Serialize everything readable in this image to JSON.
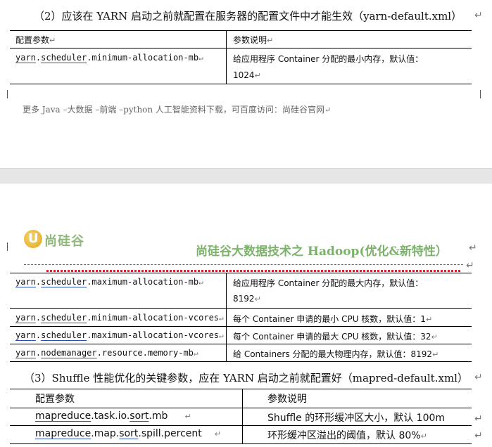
{
  "section2": {
    "heading": "（2）应该在 YARN 启动之前就配置在服务器的配置文件中才能生效（yarn-default.xml）",
    "header_param": "配置参数",
    "header_desc": "参数说明",
    "row1_param_a": "yarn",
    "row1_param_b": ".",
    "row1_param_c": "scheduler",
    "row1_param_d": ".minimum-allocation-mb",
    "row1_desc_l1": "给应用程序 Container 分配的最小内存，默认值：",
    "row1_desc_l2": "1024"
  },
  "footer": {
    "text": "更多 Java –大数据 –前端 –python 人工智能资料下载，可百度访问：尚硅谷官网"
  },
  "page_header": {
    "logo_text": "尚硅谷",
    "title": "尚硅谷大数据技术之 Hadoop(优化&新特性）"
  },
  "table2": {
    "rows": [
      {
        "p1": "yarn",
        "p2": ".",
        "p3": "scheduler",
        "p4": ".maximum-allocation-mb",
        "d1": "给应用程序 Container 分配的最大内存，默认值：",
        "d2": "8192"
      },
      {
        "p1": "yarn",
        "p2": ".",
        "p3": "scheduler",
        "p4": ".minimum-allocation-vcores",
        "d1": "每个 Container 申请的最小 CPU 核数，默认值：1"
      },
      {
        "p1": "yarn",
        "p2": ".",
        "p3": "scheduler",
        "p4": ".maximum-allocation-vcores",
        "d1": "每个 Container 申请的最大 CPU 核数，默认值：32"
      },
      {
        "p1": "yarn",
        "p2": ".",
        "p3": "nodemanager",
        "p4": ".resource.memory-mb",
        "d1": "给 Containers 分配的最大物理内存，默认值：8192"
      }
    ]
  },
  "section3": {
    "heading": "（3）Shuffle 性能优化的关键参数，应在 YARN 启动之前就配置好（mapred-default.xml）",
    "header_param": "配置参数",
    "header_desc": "参数说明",
    "rows": [
      {
        "p1": "mapreduce",
        "p2": ".task.io.",
        "p3": "sort",
        "p4": ".mb",
        "d1": "Shuffle 的环形缓冲区大小，默认 100m"
      },
      {
        "p1": "mapreduce",
        "p2": ".map.",
        "p3": "sort",
        "p4": ".spill.percent",
        "d1": "环形缓冲区溢出的阈值，默认 80%"
      }
    ]
  },
  "marks": {
    "para": "↵",
    "return_arrow": "↵"
  }
}
